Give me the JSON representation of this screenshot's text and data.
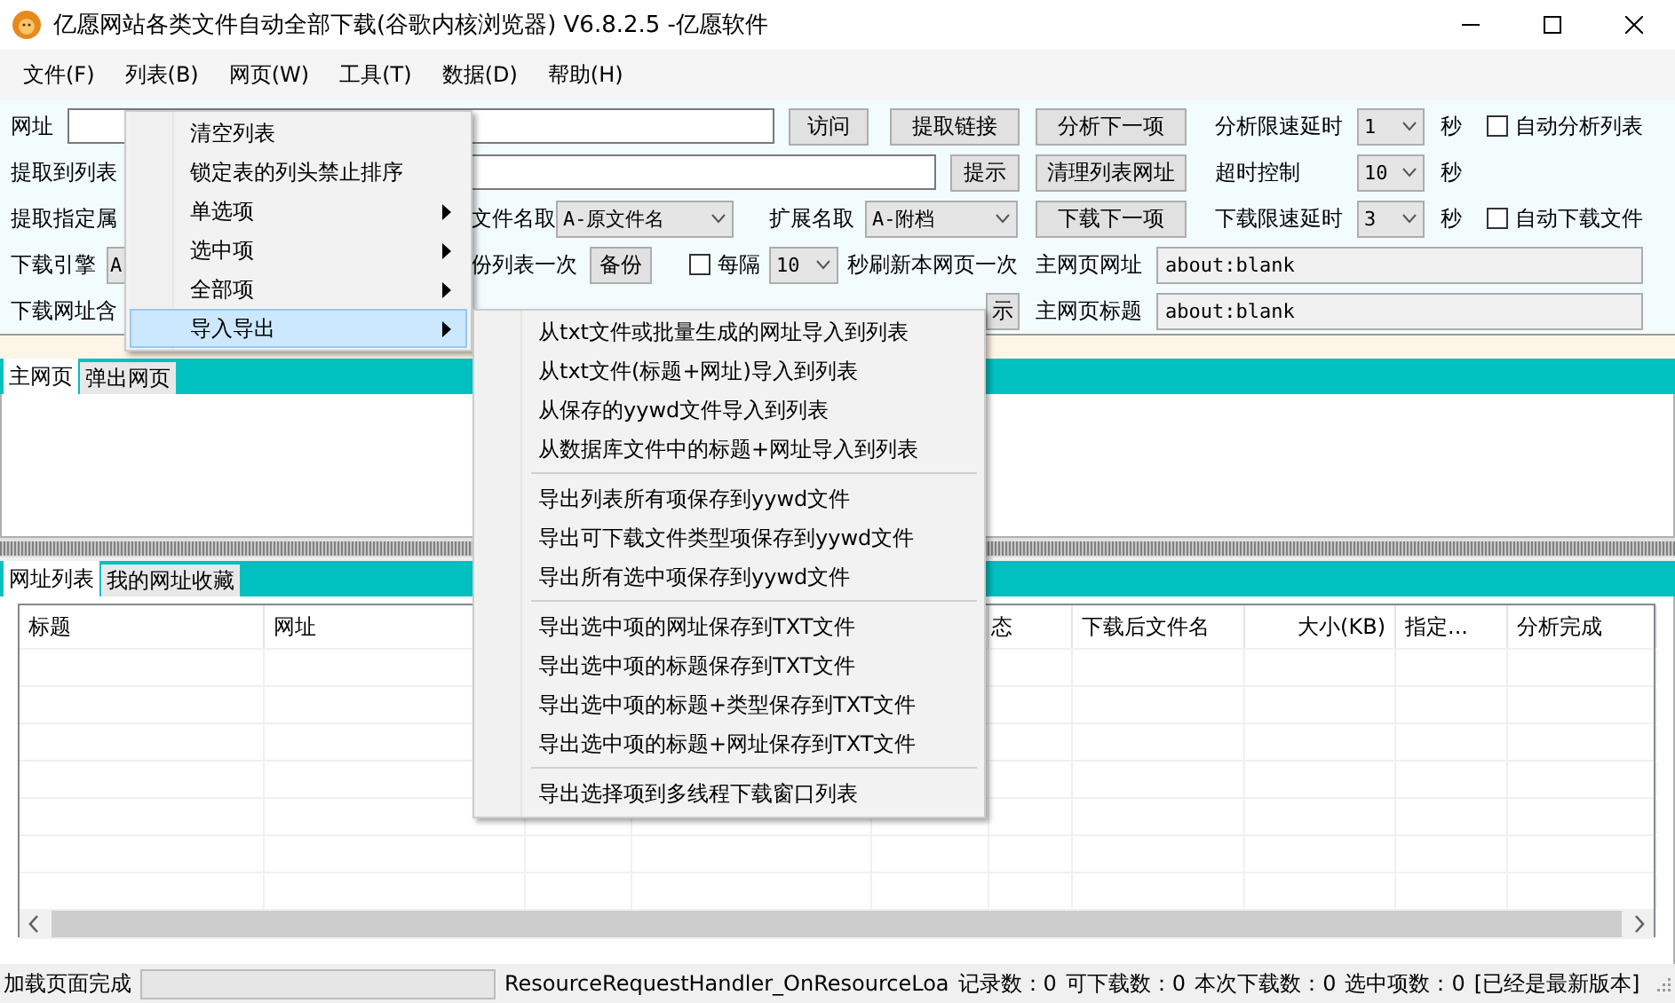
{
  "window": {
    "title": "亿愿网站各类文件自动全部下载(谷歌内核浏览器) V6.8.2.5 -亿愿软件"
  },
  "menubar": [
    "文件(F)",
    "列表(B)",
    "网页(W)",
    "工具(T)",
    "数据(D)",
    "帮助(H)"
  ],
  "form_rows": [
    [
      {
        "kind": "label",
        "text": "网址"
      },
      {
        "kind": "input"
      },
      {
        "kind": "button",
        "text": "访问"
      },
      {
        "kind": "button",
        "text": "提取链接"
      },
      {
        "kind": "button",
        "text": "分析下一项"
      },
      {
        "kind": "label",
        "text": "分析限速延时"
      },
      {
        "kind": "select",
        "value": "1"
      },
      {
        "kind": "label",
        "text": "秒"
      },
      {
        "kind": "checkbox",
        "text": "自动分析列表",
        "checked": false
      }
    ],
    [
      {
        "kind": "label",
        "text": "提取到列表"
      },
      {
        "kind": "input"
      },
      {
        "kind": "button",
        "text": "提示"
      },
      {
        "kind": "button",
        "text": "清理列表网址"
      },
      {
        "kind": "label",
        "text": "超时控制"
      },
      {
        "kind": "select",
        "value": "10"
      },
      {
        "kind": "label",
        "text": "秒"
      }
    ],
    [
      {
        "kind": "label",
        "text": "提取指定属"
      },
      {
        "kind": "label",
        "text": "文件名取"
      },
      {
        "kind": "select",
        "value": "A-原文件名"
      },
      {
        "kind": "label",
        "text": "扩展名取"
      },
      {
        "kind": "select",
        "value": "A-附档"
      },
      {
        "kind": "button",
        "text": "下载下一项"
      },
      {
        "kind": "label",
        "text": "下载限速延时"
      },
      {
        "kind": "select",
        "value": "3"
      },
      {
        "kind": "label",
        "text": "秒"
      },
      {
        "kind": "checkbox",
        "text": "自动下载文件",
        "checked": false
      }
    ],
    [
      {
        "kind": "label",
        "text": "下载引擎"
      },
      {
        "kind": "stub",
        "value": "A"
      },
      {
        "kind": "label",
        "text": "份列表一次"
      },
      {
        "kind": "button",
        "text": "备份"
      },
      {
        "kind": "checkbox",
        "text": "每隔",
        "checked": false
      },
      {
        "kind": "select",
        "value": "10"
      },
      {
        "kind": "label",
        "text": "秒刷新本网页一次"
      },
      {
        "kind": "label",
        "text": "主网页网址"
      },
      {
        "kind": "readonly",
        "value": "about:blank"
      }
    ],
    [
      {
        "kind": "label",
        "text": "下载网址含"
      },
      {
        "kind": "button",
        "text": "示"
      },
      {
        "kind": "label",
        "text": "主网页标题"
      },
      {
        "kind": "readonly",
        "value": "about:blank"
      }
    ]
  ],
  "browser_tabs": [
    {
      "label": "主网页",
      "selected": true
    },
    {
      "label": "弹出网页",
      "selected": false
    }
  ],
  "list_tabs": [
    {
      "label": "网址列表",
      "selected": true
    },
    {
      "label": "我的网址收藏",
      "selected": false
    }
  ],
  "table": {
    "columns": [
      "标题",
      "网址",
      "态",
      "下载后文件名",
      "大小(KB)",
      "指定...",
      "分析完成"
    ]
  },
  "status_bar": {
    "message": "加载页面完成",
    "event": "ResourceRequestHandler_OnResourceLoa",
    "counts": [
      "记录数：0",
      "可下载数：0",
      "本次下载数：0",
      "选中项数：0"
    ],
    "version": "[已经是最新版本]"
  },
  "list_menu": {
    "items": [
      {
        "label": "清空列表",
        "has_submenu": false,
        "selected": false
      },
      {
        "label": "锁定表的列头禁止排序",
        "has_submenu": false,
        "selected": false
      },
      {
        "label": "单选项",
        "has_submenu": true,
        "selected": false
      },
      {
        "label": "选中项",
        "has_submenu": true,
        "selected": false
      },
      {
        "label": "全部项",
        "has_submenu": true,
        "selected": false
      },
      {
        "label": "导入导出",
        "has_submenu": true,
        "selected": true
      }
    ]
  },
  "import_export_menu": {
    "groups": [
      [
        "从txt文件或批量生成的网址导入到列表",
        "从txt文件(标题+网址)导入到列表",
        "从保存的yywd文件导入到列表",
        "从数据库文件中的标题+网址导入到列表"
      ],
      [
        "导出列表所有项保存到yywd文件",
        "导出可下载文件类型项保存到yywd文件",
        "导出所有选中项保存到yywd文件"
      ],
      [
        "导出选中项的网址保存到TXT文件",
        "导出选中项的标题保存到TXT文件",
        "导出选中项的标题+类型保存到TXT文件",
        "导出选中项的标题+网址保存到TXT文件"
      ],
      [
        "导出选择项到多线程下载窗口列表"
      ]
    ]
  }
}
